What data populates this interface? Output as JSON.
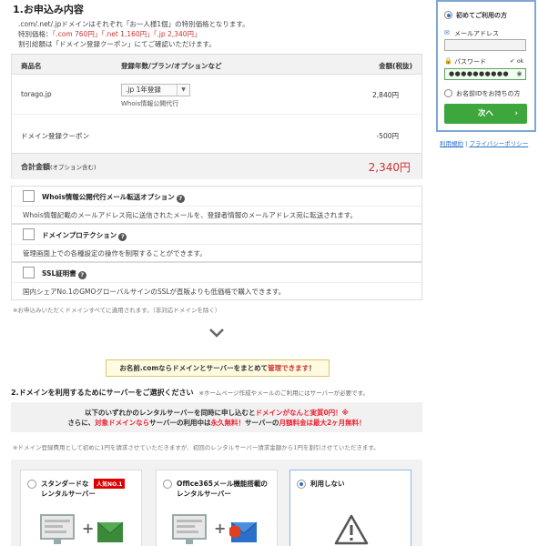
{
  "section1": {
    "title": "1.お申込み内容",
    "intro_line1": ".com/.net/.jpドメインはそれぞれ「お一人様1個」の特別価格となります。",
    "intro_line2_prefix": "特別価格：",
    "intro_line2_red": "「.com 760円」「.net 1,160円」「.jp 2,340円」",
    "intro_line3": "割引総額は「ドメイン登録クーポン」にてご確認いただけます。"
  },
  "order_table": {
    "headers": {
      "name": "商品名",
      "plan": "登録年数/プラン/オプションなど",
      "price": "金額(税抜)"
    },
    "domain_row": {
      "name": "torago.jp",
      "plan_value": ".jp 1年登録",
      "plan_note": "Whois情報公開代行",
      "price": "2,840円"
    },
    "coupon_row": {
      "name": "ドメイン登録クーポン",
      "price": "-500円"
    },
    "total": {
      "label": "合計金額",
      "label_note": "(オプション含む)",
      "price": "2,340円"
    }
  },
  "options": [
    {
      "title": "Whois情報公開代行メール転送オプション",
      "desc": "Whois情報記載のメールアドレス宛に送信されたメールを、登録者情報のメールアドレス宛に転送されます。"
    },
    {
      "title": "ドメインプロテクション",
      "desc": "管理画面上での各種設定の操作を制限することができます。"
    },
    {
      "title": "SSL証明書",
      "desc": "国内シェアNo.1のGMOグローバルサインのSSLが直販よりも低価格で購入できます。"
    }
  ],
  "note_options": "※お申込みいただくドメインすべてに適用されます。（非対応ドメインを除く）",
  "promo": {
    "prefix": "お名前.comならドメインとサーバーをまとめて",
    "red": "管理できます",
    "suffix": "！"
  },
  "section2": {
    "title": "2.ドメインを利用するためにサーバーをご選択ください",
    "subtitle": "※ホームページ作成やメールのご利用にはサーバーが必要です。",
    "offer_line1_prefix": "以下のいずれかのレンタルサーバーを同時に申し込むと",
    "offer_line1_red": "ドメインがなんと実質0円！",
    "offer_line1_suffix": "※",
    "offer_line2_prefix": "さらに、",
    "offer_line2_red1": "対象ドメインなら",
    "offer_line2_mid": "サーバーの利用中は",
    "offer_line2_red2": "永久無料！",
    "offer_line2_mid2": "サーバーの",
    "offer_line2_red3": "月額料金は最大2ヶ月無料！",
    "note": "※ドメイン登録費用として初めに1円を請求させていただきますが、初回のレンタルサーバー請求金額から1円を割引させていただきます。"
  },
  "servers": [
    {
      "title_line1": "スタンダードな",
      "title_line2": "レンタルサーバー",
      "badge": "人気NO.1",
      "selected": false
    },
    {
      "title_line1": "Office365メール機能搭載の",
      "title_line2": "レンタルサーバー",
      "selected": false
    },
    {
      "title_line1": "利用しない",
      "title_line2": "",
      "selected": true
    }
  ],
  "login": {
    "first_time_label": "初めてご利用の方",
    "email_label": "メールアドレス",
    "password_label": "パスワード",
    "ok_label": "ok",
    "password_value": "●●●●●●●●●●",
    "member_label": "お名前IDをお持ちの方",
    "next_label": "次へ",
    "terms_link": "利用規約",
    "privacy_link": "プライバシーポリシー"
  },
  "colors": {
    "accent_red": "#c33",
    "next_green": "#3da63d",
    "login_border": "#7fa7d6"
  }
}
